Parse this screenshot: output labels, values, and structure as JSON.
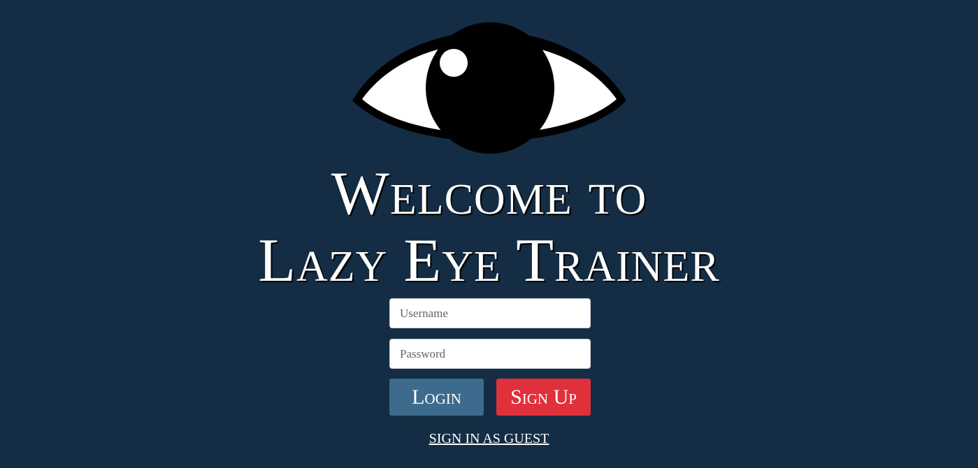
{
  "header": {
    "logo_icon": "eye-icon",
    "title_line1": "Welcome to",
    "title_line2": "Lazy Eye Trainer"
  },
  "form": {
    "username_placeholder": "Username",
    "username_value": "",
    "password_placeholder": "Password",
    "password_value": "",
    "login_label": "Login",
    "signup_label": "Sign Up",
    "guest_label": "SIGN IN AS GUEST"
  },
  "colors": {
    "background": "#142d44",
    "login_button": "#3d6b8d",
    "signup_button": "#e0303b"
  }
}
